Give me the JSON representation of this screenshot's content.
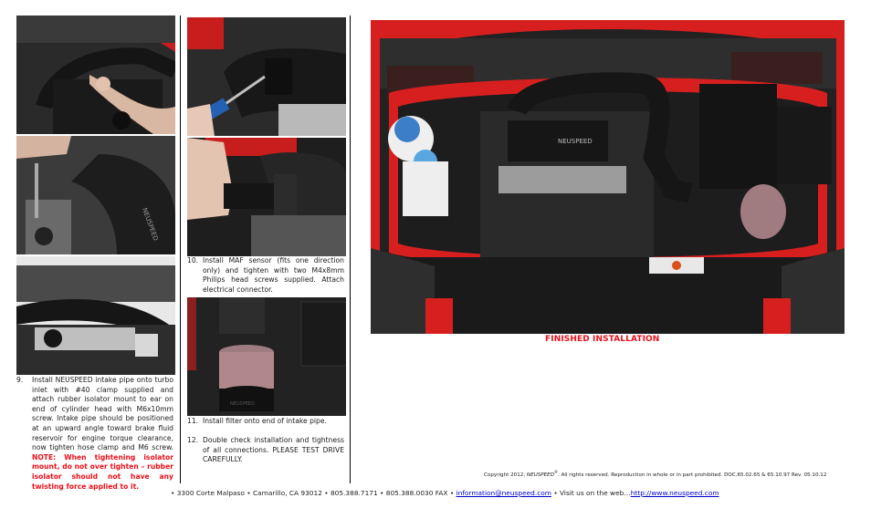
{
  "photos": {
    "step9_a": {
      "alt": "Hands installing intake pipe on engine"
    },
    "step9_b": {
      "alt": "Intake pipe with NEUSPEED lettering near brake fluid reservoir"
    },
    "step9_c": {
      "alt": "Intake pipe routed over engine"
    },
    "step10_a": {
      "alt": "Screwdriver tightening MAF sensor screws"
    },
    "step10_b": {
      "alt": "Attaching MAF electrical connector"
    },
    "step11": {
      "alt": "Air filter installed on end of intake pipe"
    },
    "finished": {
      "alt": "Engine bay with finished NEUSPEED intake installation"
    }
  },
  "steps": [
    {
      "number": "9.",
      "text": "Install NEUSPEED intake pipe onto turbo inlet with #40 clamp supplied and attach rubber isolator mount to ear on end of cylinder head with M6x10mm screw. Intake pipe should be positioned at an upward angle toward brake fluid reservoir for engine torque clearance, now tighten hose clamp and M6 screw.",
      "note": "NOTE: When tightening isolator mount, do not over tighten – rubber isolator should not have any twisting force applied to it."
    },
    {
      "number": "10.",
      "text": "Install MAF sensor (fits one direction only) and tighten with two M4x8mm Philips head screws supplied. Attach electrical connector."
    },
    {
      "number": "11.",
      "text": "Install filter onto end of intake pipe."
    },
    {
      "number": "12.",
      "text": "Double check installation and tightness of all connections.  PLEASE TEST DRIVE CAREFULLY."
    }
  ],
  "caption": "FINISHED INSTALLATION",
  "copyright": {
    "prefix": "Copyright 2012, ",
    "brand": "NEUSPEED",
    "mark": "®",
    "suffix": ".  All rights reserved.  Reproduction in whole or in part prohibited.  DOC.65.02.65 & 65.10.97  Rev. 05.10.12"
  },
  "footer": {
    "address": "• 3300 Corte Malpaso • Camarillo, CA 93012 • 805.388.7171 • 805.388.0030 FAX • ",
    "email": "information@neuspeed.com",
    "middle": " • Visit us on the web…",
    "website": "http://www.neuspeed.com"
  },
  "colors": {
    "note_red": "#e8101a",
    "link_blue": "#0000cc",
    "car_red": "#d81f1f"
  }
}
